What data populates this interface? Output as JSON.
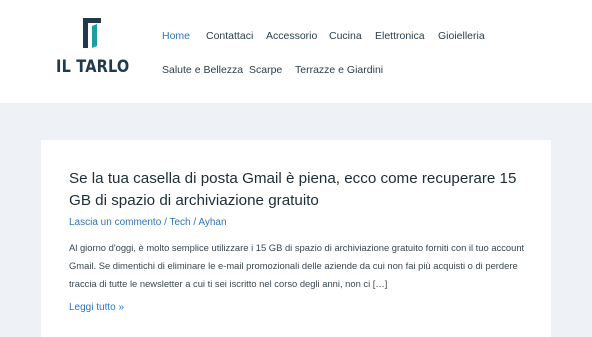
{
  "site": {
    "logo_text": "IL TARLO",
    "brand_color": "#1f3a4d",
    "accent_color": "#1aa0a0"
  },
  "nav": {
    "items": [
      {
        "label": "Home",
        "active": true
      },
      {
        "label": "Contattaci"
      },
      {
        "label": "Accessorio"
      },
      {
        "label": "Cucina"
      },
      {
        "label": "Elettronica"
      },
      {
        "label": "Gioielleria"
      },
      {
        "label": "Salute e Bellezza"
      },
      {
        "label": "Scarpe"
      },
      {
        "label": "Terrazze e Giardini"
      }
    ],
    "active_color": "#2e76b8",
    "text_color": "#2b3e4a"
  },
  "post": {
    "title": "Se la tua casella di posta Gmail è piena, ecco come recuperare 15 GB di spazio di archiviazione gratuito",
    "meta": {
      "comments": "Lascia un commento",
      "separator": "/",
      "category": "Tech",
      "author": "Ayhan"
    },
    "excerpt": "Al giorno d'oggi, è molto semplice utilizzare i 15 GB di spazio di archiviazione gratuito forniti con il tuo account Gmail. Se dimentichi di eliminare le e-mail promozionali delle aziende da cui non fai più acquisti o di perdere traccia di tutte le newsletter a cui ti sei iscritto nel corso degli anni, non ci […]",
    "read_more": "Leggi tutto »"
  }
}
